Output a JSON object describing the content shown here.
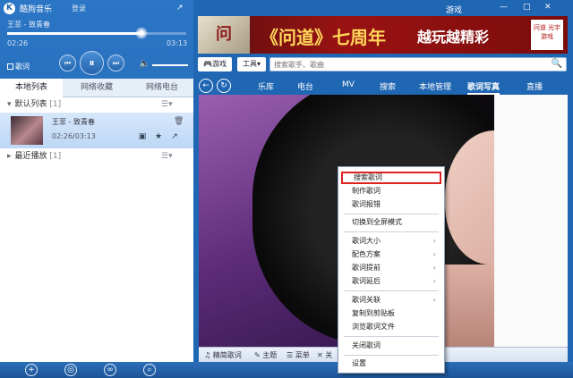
{
  "app": {
    "title": "酷狗音乐",
    "login_label": "登录",
    "logo_letter": "K"
  },
  "player": {
    "now_playing": "王菲 - 致青春",
    "time_current": "02:26",
    "time_total": "03:13",
    "progress_fraction": 0.75,
    "lyric_toggle": "歌词",
    "prev_icon": "⏮",
    "play_icon": "⏸",
    "next_icon": "⏭",
    "volume_icon": "🔈"
  },
  "left_tabs": [
    {
      "label": "本地列表"
    },
    {
      "label": "网络收藏"
    },
    {
      "label": "网络电台"
    }
  ],
  "playlist": {
    "default_group": {
      "name": "默认列表",
      "count": "[1]"
    },
    "song": {
      "name": "王菲 - 致青春",
      "time": "02:26/03:13"
    },
    "recent_group": {
      "name": "最近播放",
      "count": "[1]"
    },
    "menu_icon": "☰▾"
  },
  "right_top": {
    "game_link": "游戏",
    "minimize": "—",
    "maximize": "□",
    "close": "✕"
  },
  "banner": {
    "art_text": "问",
    "title": "《问道》七周年",
    "slogan": "越玩越精彩",
    "badge": "问道 光宇游戏"
  },
  "toolbar": {
    "game_button": "游戏",
    "tools_button": "工具▾",
    "search_placeholder": "搜索歌手、歌曲",
    "search_icon": "🔍"
  },
  "nav": {
    "back_icon": "←",
    "refresh_icon": "↻",
    "items": [
      "乐库",
      "电台",
      "MV",
      "搜索",
      "本地管理",
      "歌词写真",
      "直播"
    ]
  },
  "lyric_bar": {
    "items": [
      "♫ 精简歌词",
      "✎ 主题",
      "☰ 菜单",
      "✕ 关"
    ]
  },
  "context_menu": {
    "items": [
      {
        "label": "搜索歌词"
      },
      {
        "label": "制作歌词"
      },
      {
        "label": "歌词报错"
      },
      {
        "label": "切换到全屏模式"
      },
      {
        "label": "歌词大小",
        "sub": "›"
      },
      {
        "label": "配色方案",
        "sub": "›"
      },
      {
        "label": "歌词提前",
        "sub": "›"
      },
      {
        "label": "歌词延后",
        "sub": "›"
      },
      {
        "label": "歌词关联",
        "sub": "›"
      },
      {
        "label": "复制到剪贴板"
      },
      {
        "label": "浏览歌词文件"
      },
      {
        "label": "关闭歌词"
      },
      {
        "label": "设置"
      }
    ]
  },
  "colors": {
    "accent_blue": "#1f66b3",
    "highlight_border": "#dd2222"
  }
}
